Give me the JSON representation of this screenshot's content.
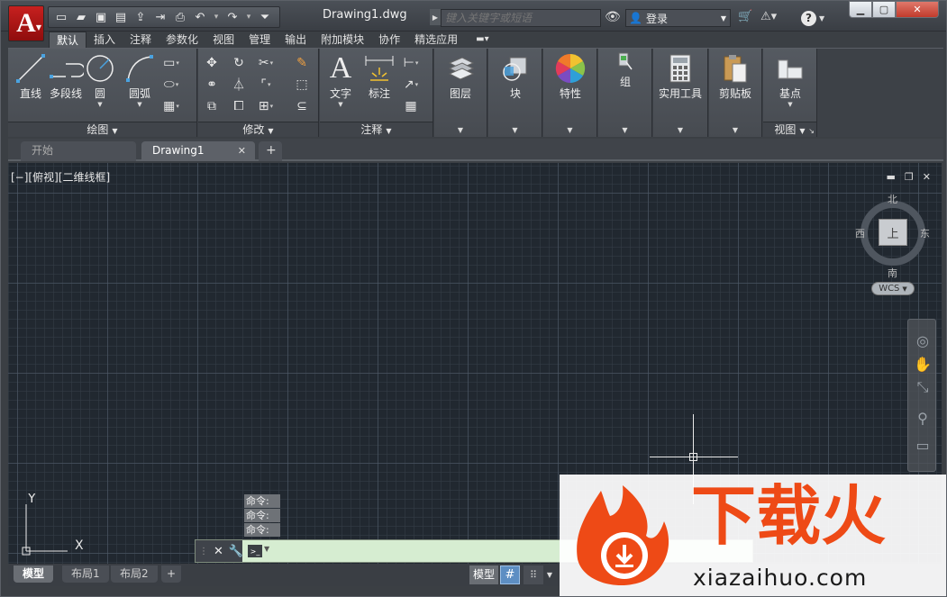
{
  "title_bar": {
    "doc_title": "Drawing1.dwg",
    "search_placeholder": "键入关键字或短语",
    "login_label": "登录",
    "app_button_letter": "A"
  },
  "ribbon_tabs": [
    "默认",
    "插入",
    "注释",
    "参数化",
    "视图",
    "管理",
    "输出",
    "附加模块",
    "协作",
    "精选应用"
  ],
  "panels": {
    "draw": {
      "title": "绘图",
      "tools": [
        "直线",
        "多段线",
        "圆",
        "圆弧"
      ]
    },
    "modify": {
      "title": "修改"
    },
    "annotation": {
      "title": "注释",
      "tools": [
        "文字",
        "标注"
      ]
    },
    "layers": {
      "label": "图层"
    },
    "block": {
      "label": "块"
    },
    "properties": {
      "label": "特性"
    },
    "group": {
      "label": "组"
    },
    "utilities": {
      "label": "实用工具"
    },
    "clipboard": {
      "label": "剪贴板"
    },
    "view": {
      "tool_label": "基点",
      "title": "视图"
    }
  },
  "file_tabs": {
    "start": "开始",
    "drawing": "Drawing1",
    "add": "+"
  },
  "viewport": {
    "label": "[−][俯视][二维线框]",
    "viewcube": {
      "north": "北",
      "south": "南",
      "east": "东",
      "west": "西",
      "face": "上"
    },
    "wcs": "WCS"
  },
  "ucs": {
    "x": "X",
    "y": "Y"
  },
  "command": {
    "history": [
      "命令:",
      "命令:",
      "命令:"
    ]
  },
  "status_bar": {
    "layout_tabs": [
      "模型",
      "布局1",
      "布局2"
    ],
    "add_tab": "+",
    "model_button": "模型"
  },
  "watermark": {
    "text_cn": "下载火",
    "url": "xiazaihuo.com"
  },
  "colors": {
    "app_red": "#c7201f",
    "canvas_bg": "#212830",
    "command_bg": "#d6edd1",
    "watermark_orange": "#ee4a16"
  }
}
